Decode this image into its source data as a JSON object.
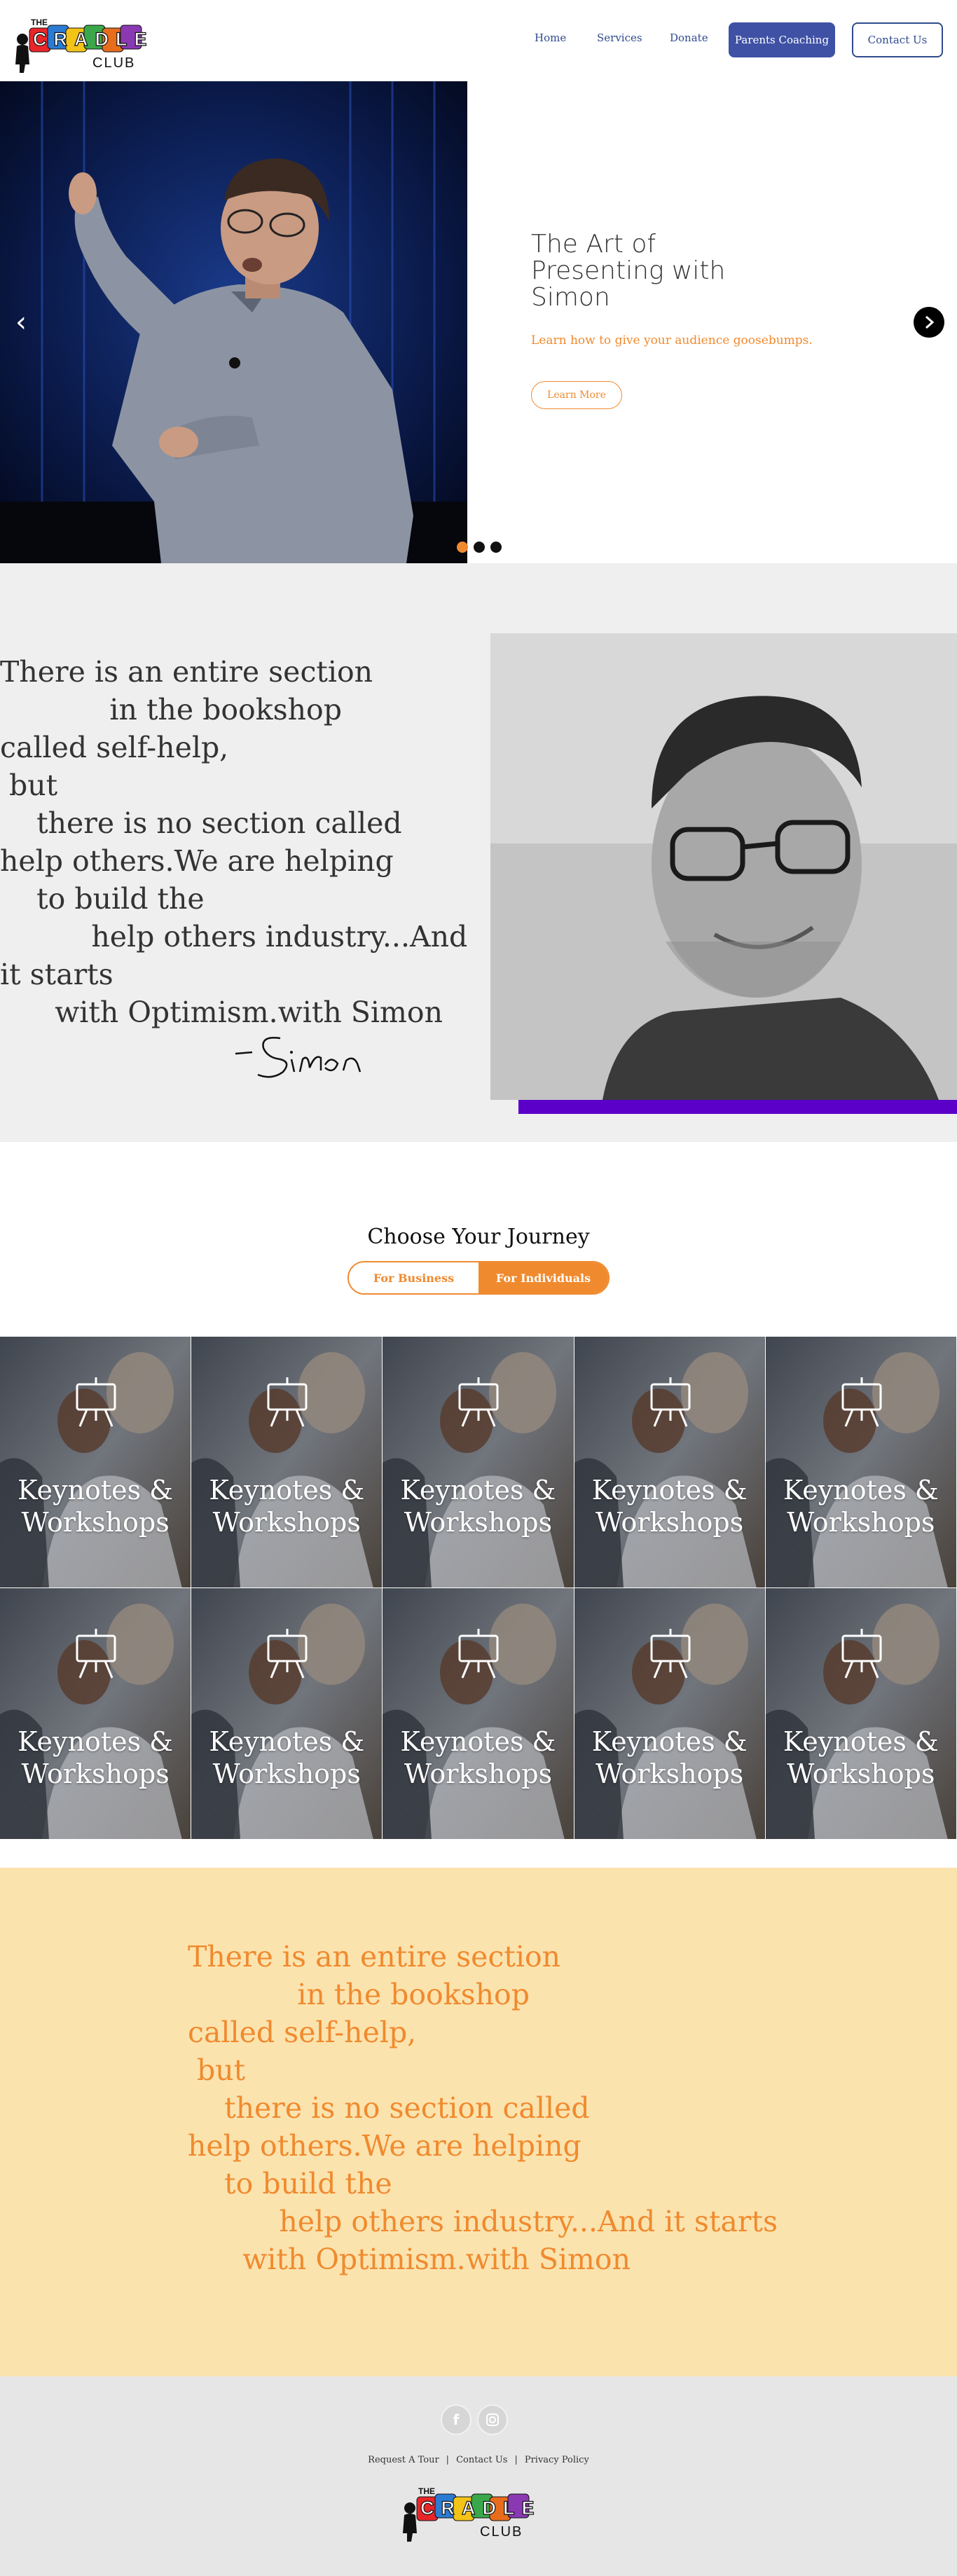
{
  "nav": {
    "logo": {
      "the": "THE",
      "cradle": "CRADLE",
      "club": "CLUB"
    },
    "links": [
      "Home",
      "Services",
      "Donate"
    ],
    "parents_coaching": "Parents Coaching",
    "contact_us": "Contact Us"
  },
  "hero": {
    "title": "The Art of Presenting with Simon",
    "subtitle": "Learn how to give your audience goosebumps.",
    "cta": "Learn More",
    "prev_icon": "chevron-left-icon",
    "next_icon": "chevron-right-circle-icon",
    "dots": 3,
    "active_dot": 1
  },
  "quote": {
    "text": "There is an entire section\n            in the bookshop\ncalled self-help,\n but\n    there is no section called\nhelp others.We are helping\n    to build the\n          help others industry...And\nit starts\n      with Optimism.with Simon",
    "signature": "-Simon"
  },
  "journey": {
    "title": "Choose Your Journey",
    "options": [
      "For Business",
      "For Individuals"
    ],
    "selected": "For Individuals"
  },
  "tiles": [
    {
      "label": "Keynotes & Workshops"
    },
    {
      "label": "Keynotes & Workshops"
    },
    {
      "label": "Keynotes & Workshops"
    },
    {
      "label": "Keynotes & Workshops"
    },
    {
      "label": "Keynotes & Workshops"
    },
    {
      "label": "Keynotes & Workshops"
    },
    {
      "label": "Keynotes & Workshops"
    },
    {
      "label": "Keynotes & Workshops"
    },
    {
      "label": "Keynotes & Workshops"
    },
    {
      "label": "Keynotes & Workshops"
    }
  ],
  "yellow_quote": {
    "text": "There is an entire section\n            in the bookshop\ncalled self-help,\n but\n    there is no section called\nhelp others.We are helping\n    to build the\n          help others industry...And it starts\n      with Optimism.with Simon"
  },
  "footer": {
    "social": [
      "facebook-icon",
      "instagram-icon"
    ],
    "links": [
      "Request A Tour",
      "Contact Us",
      "Privacy Policy"
    ]
  },
  "colors": {
    "accent_orange": "#f08a2e",
    "nav_blue": "#3f51a5",
    "purple": "#5a00c9",
    "yellow_bg": "#fbe3ae"
  }
}
